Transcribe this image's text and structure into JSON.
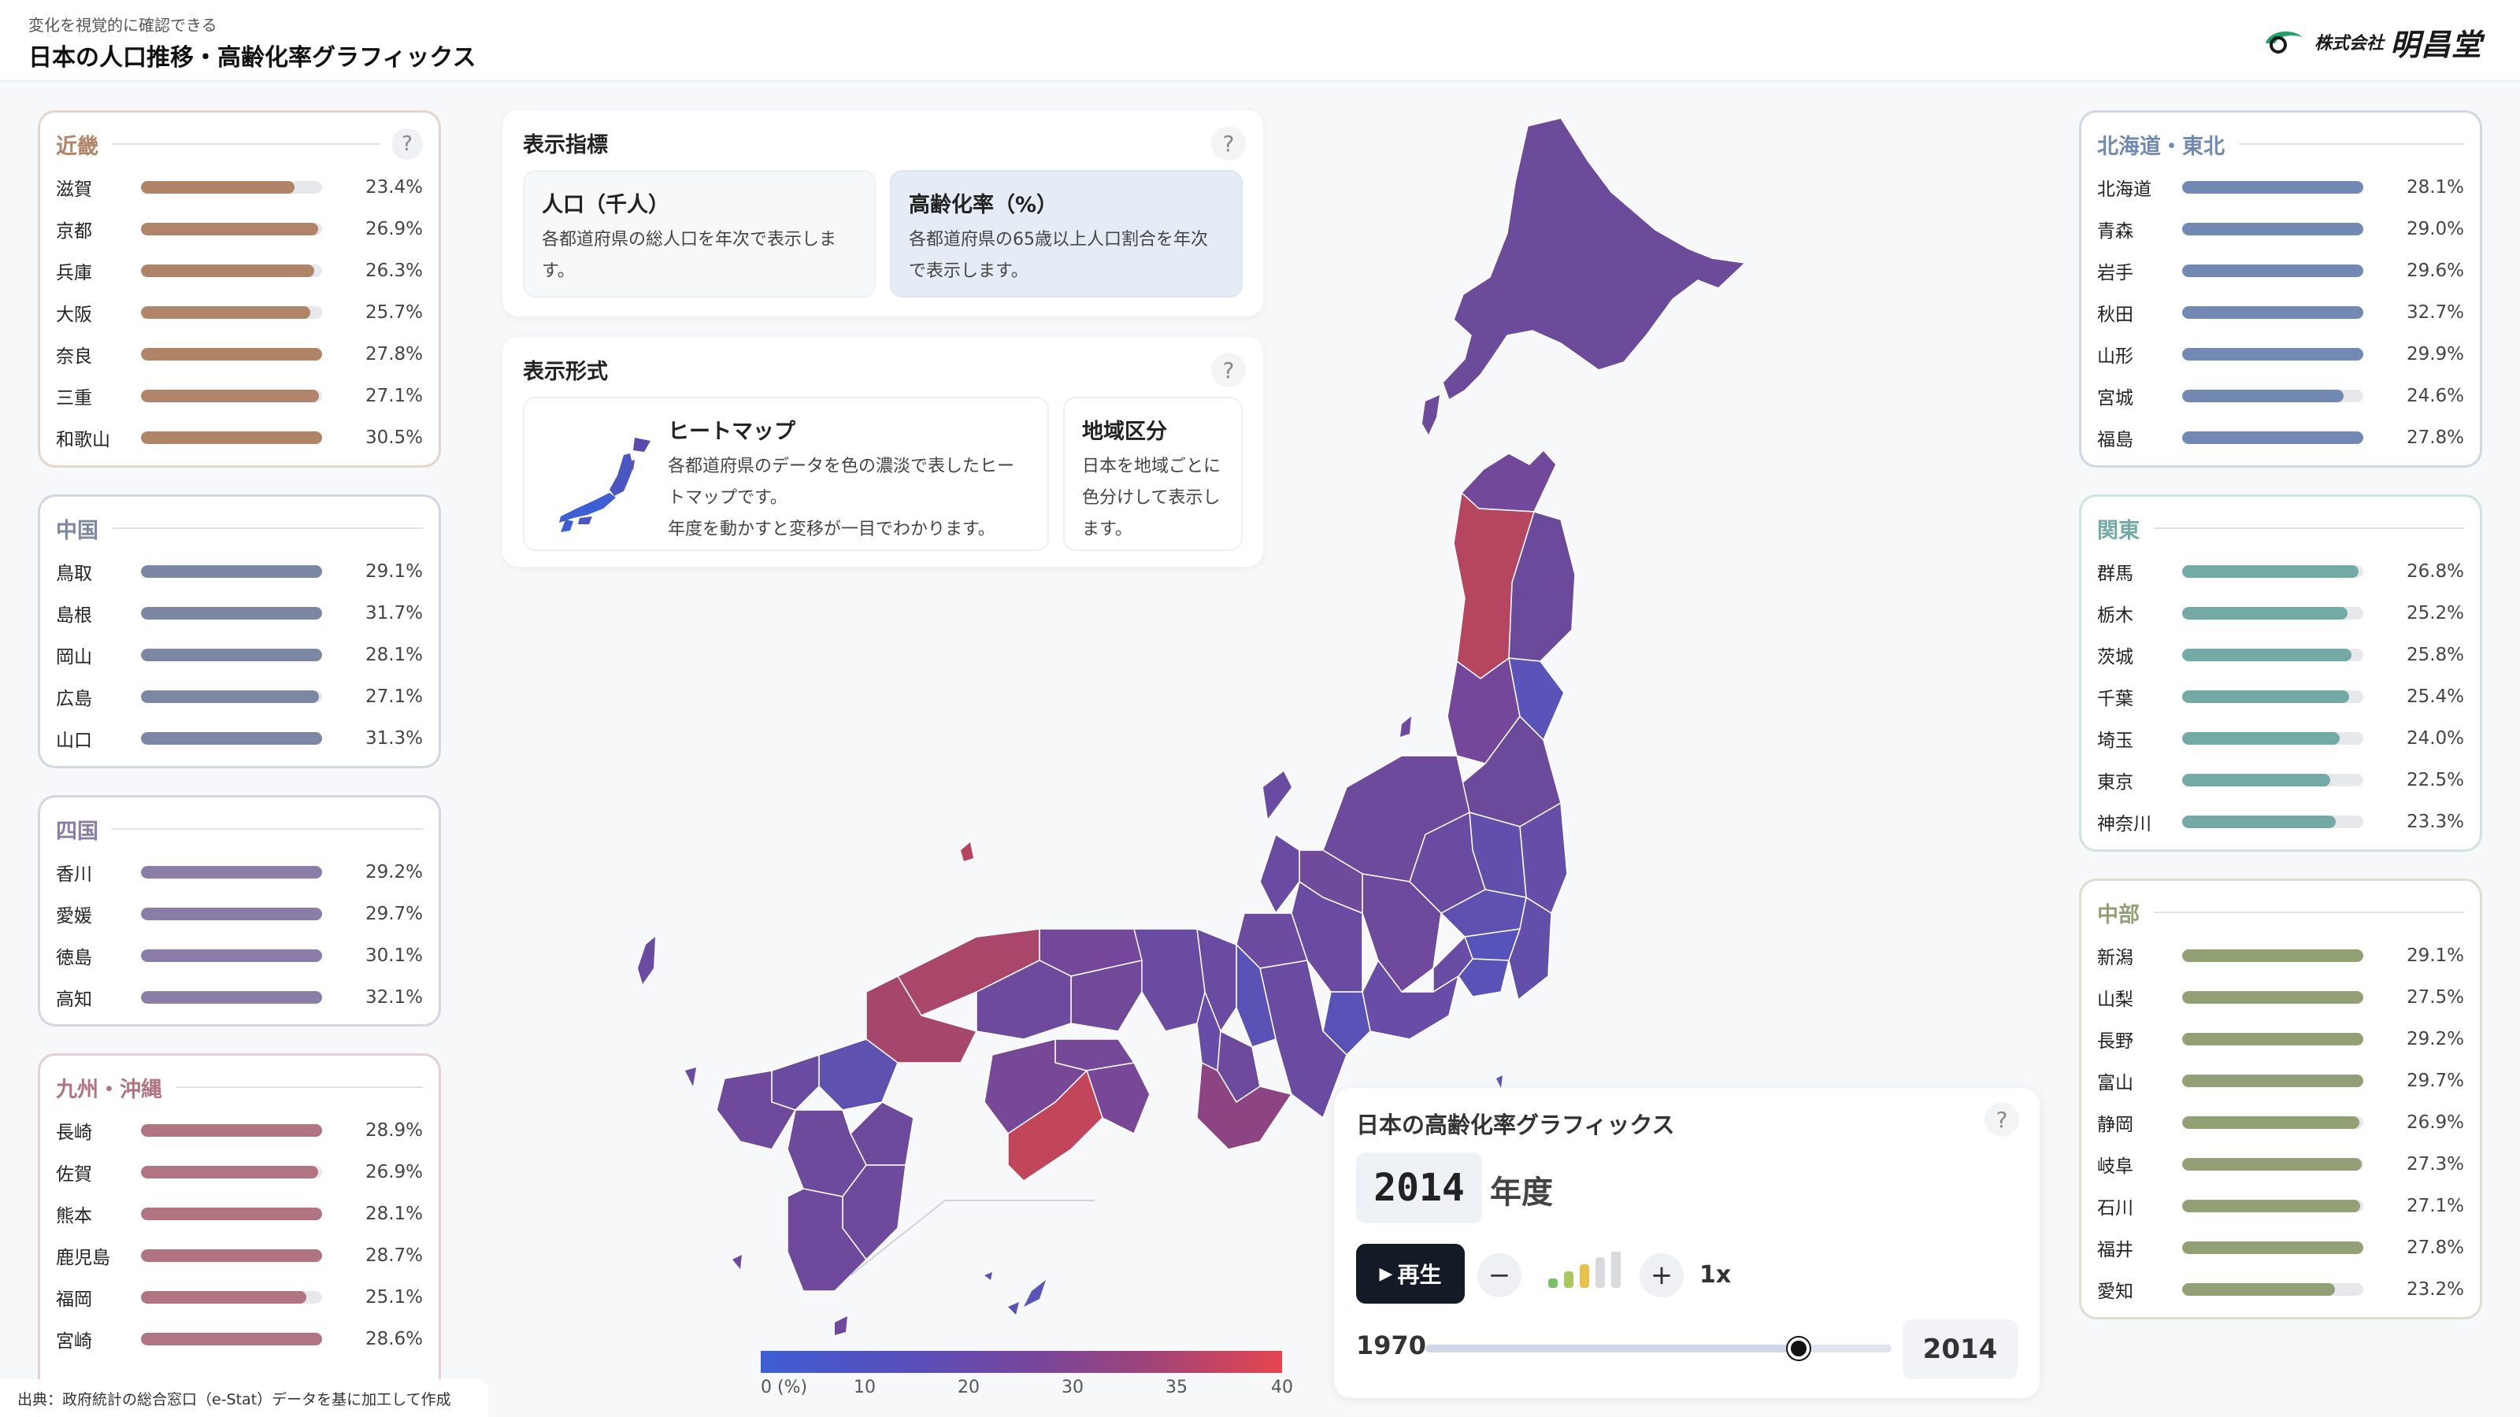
{
  "header": {
    "subtitle": "変化を視覚的に確認できる",
    "title": "日本の人口推移・高齢化率グラフィックス",
    "logo_prefix": "株式会社",
    "logo_name": "明昌堂"
  },
  "regions": {
    "kinki": {
      "name": "近畿",
      "color": "#b08469",
      "help": "?",
      "items": [
        {
          "name": "滋賀",
          "value": 23.4,
          "label": "23.4%"
        },
        {
          "name": "京都",
          "value": 26.9,
          "label": "26.9%"
        },
        {
          "name": "兵庫",
          "value": 26.3,
          "label": "26.3%"
        },
        {
          "name": "大阪",
          "value": 25.7,
          "label": "25.7%"
        },
        {
          "name": "奈良",
          "value": 27.8,
          "label": "27.8%"
        },
        {
          "name": "三重",
          "value": 27.1,
          "label": "27.1%"
        },
        {
          "name": "和歌山",
          "value": 30.5,
          "label": "30.5%"
        }
      ]
    },
    "chugoku": {
      "name": "中国",
      "color": "#7c88a3",
      "items": [
        {
          "name": "鳥取",
          "value": 29.1,
          "label": "29.1%"
        },
        {
          "name": "島根",
          "value": 31.7,
          "label": "31.7%"
        },
        {
          "name": "岡山",
          "value": 28.1,
          "label": "28.1%"
        },
        {
          "name": "広島",
          "value": 27.1,
          "label": "27.1%"
        },
        {
          "name": "山口",
          "value": 31.3,
          "label": "31.3%"
        }
      ]
    },
    "shikoku": {
      "name": "四国",
      "color": "#8a7ea8",
      "items": [
        {
          "name": "香川",
          "value": 29.2,
          "label": "29.2%"
        },
        {
          "name": "愛媛",
          "value": 29.7,
          "label": "29.7%"
        },
        {
          "name": "徳島",
          "value": 30.1,
          "label": "30.1%"
        },
        {
          "name": "高知",
          "value": 32.1,
          "label": "32.1%"
        }
      ]
    },
    "kyushu": {
      "name": "九州・沖縄",
      "color": "#b07482",
      "items": [
        {
          "name": "長崎",
          "value": 28.9,
          "label": "28.9%"
        },
        {
          "name": "佐賀",
          "value": 26.9,
          "label": "26.9%"
        },
        {
          "name": "熊本",
          "value": 28.1,
          "label": "28.1%"
        },
        {
          "name": "鹿児島",
          "value": 28.7,
          "label": "28.7%"
        },
        {
          "name": "福岡",
          "value": 25.1,
          "label": "25.1%"
        },
        {
          "name": "宮崎",
          "value": 28.6,
          "label": "28.6%"
        }
      ]
    },
    "hokkaido": {
      "name": "北海道・東北",
      "color": "#7189b3",
      "items": [
        {
          "name": "北海道",
          "value": 28.1,
          "label": "28.1%"
        },
        {
          "name": "青森",
          "value": 29.0,
          "label": "29.0%"
        },
        {
          "name": "岩手",
          "value": 29.6,
          "label": "29.6%"
        },
        {
          "name": "秋田",
          "value": 32.7,
          "label": "32.7%"
        },
        {
          "name": "山形",
          "value": 29.9,
          "label": "29.9%"
        },
        {
          "name": "宮城",
          "value": 24.6,
          "label": "24.6%"
        },
        {
          "name": "福島",
          "value": 27.8,
          "label": "27.8%"
        }
      ]
    },
    "kanto": {
      "name": "関東",
      "color": "#74aaa5",
      "items": [
        {
          "name": "群馬",
          "value": 26.8,
          "label": "26.8%"
        },
        {
          "name": "栃木",
          "value": 25.2,
          "label": "25.2%"
        },
        {
          "name": "茨城",
          "value": 25.8,
          "label": "25.8%"
        },
        {
          "name": "千葉",
          "value": 25.4,
          "label": "25.4%"
        },
        {
          "name": "埼玉",
          "value": 24.0,
          "label": "24.0%"
        },
        {
          "name": "東京",
          "value": 22.5,
          "label": "22.5%"
        },
        {
          "name": "神奈川",
          "value": 23.3,
          "label": "23.3%"
        }
      ]
    },
    "chubu": {
      "name": "中部",
      "color": "#93a075",
      "items": [
        {
          "name": "新潟",
          "value": 29.1,
          "label": "29.1%"
        },
        {
          "name": "山梨",
          "value": 27.5,
          "label": "27.5%"
        },
        {
          "name": "長野",
          "value": 29.2,
          "label": "29.2%"
        },
        {
          "name": "富山",
          "value": 29.7,
          "label": "29.7%"
        },
        {
          "name": "静岡",
          "value": 26.9,
          "label": "26.9%"
        },
        {
          "name": "岐阜",
          "value": 27.3,
          "label": "27.3%"
        },
        {
          "name": "石川",
          "value": 27.1,
          "label": "27.1%"
        },
        {
          "name": "福井",
          "value": 27.8,
          "label": "27.8%"
        },
        {
          "name": "愛知",
          "value": 23.2,
          "label": "23.2%"
        }
      ]
    }
  },
  "bar_max": 40,
  "indicator": {
    "title": "表示指標",
    "help": "?",
    "options": [
      {
        "title": "人口（千人）",
        "desc": "各都道府県の総人口を年次で表示します。",
        "selected": false
      },
      {
        "title": "高齢化率（%）",
        "desc": "各都道府県の65歳以上人口割合を年次で表示します。",
        "selected": true
      }
    ]
  },
  "format": {
    "title": "表示形式",
    "help": "?",
    "heatmap": {
      "title": "ヒートマップ",
      "desc1": "各都道府県のデータを色の濃淡で表したヒートマップです。",
      "desc2": "年度を動かすと変移が一目でわかります。"
    },
    "region": {
      "title": "地域区分",
      "desc": "日本を地域ごとに色分けして表示します。"
    }
  },
  "control": {
    "title": "日本の高齢化率グラフィックス",
    "help": "?",
    "year": "2014",
    "year_suffix": "年度",
    "play_label": "再生",
    "minus": "−",
    "plus": "+",
    "speed_level": 3,
    "speed_max": 5,
    "multiplier": "1x",
    "slider_min": "1970",
    "slider_max": "2014",
    "slider_min_value": 1970,
    "slider_max_value": 2014,
    "slider_value": 2014,
    "slider_fraction": 0.8
  },
  "legend": {
    "ticks": [
      "0 (%)",
      "10",
      "20",
      "30",
      "35",
      "40"
    ],
    "colors": [
      "#3e5ed4",
      "#e6454e"
    ]
  },
  "source": "出典：政府統計の総合窓口（e-Stat）データを基に加工して作成"
}
